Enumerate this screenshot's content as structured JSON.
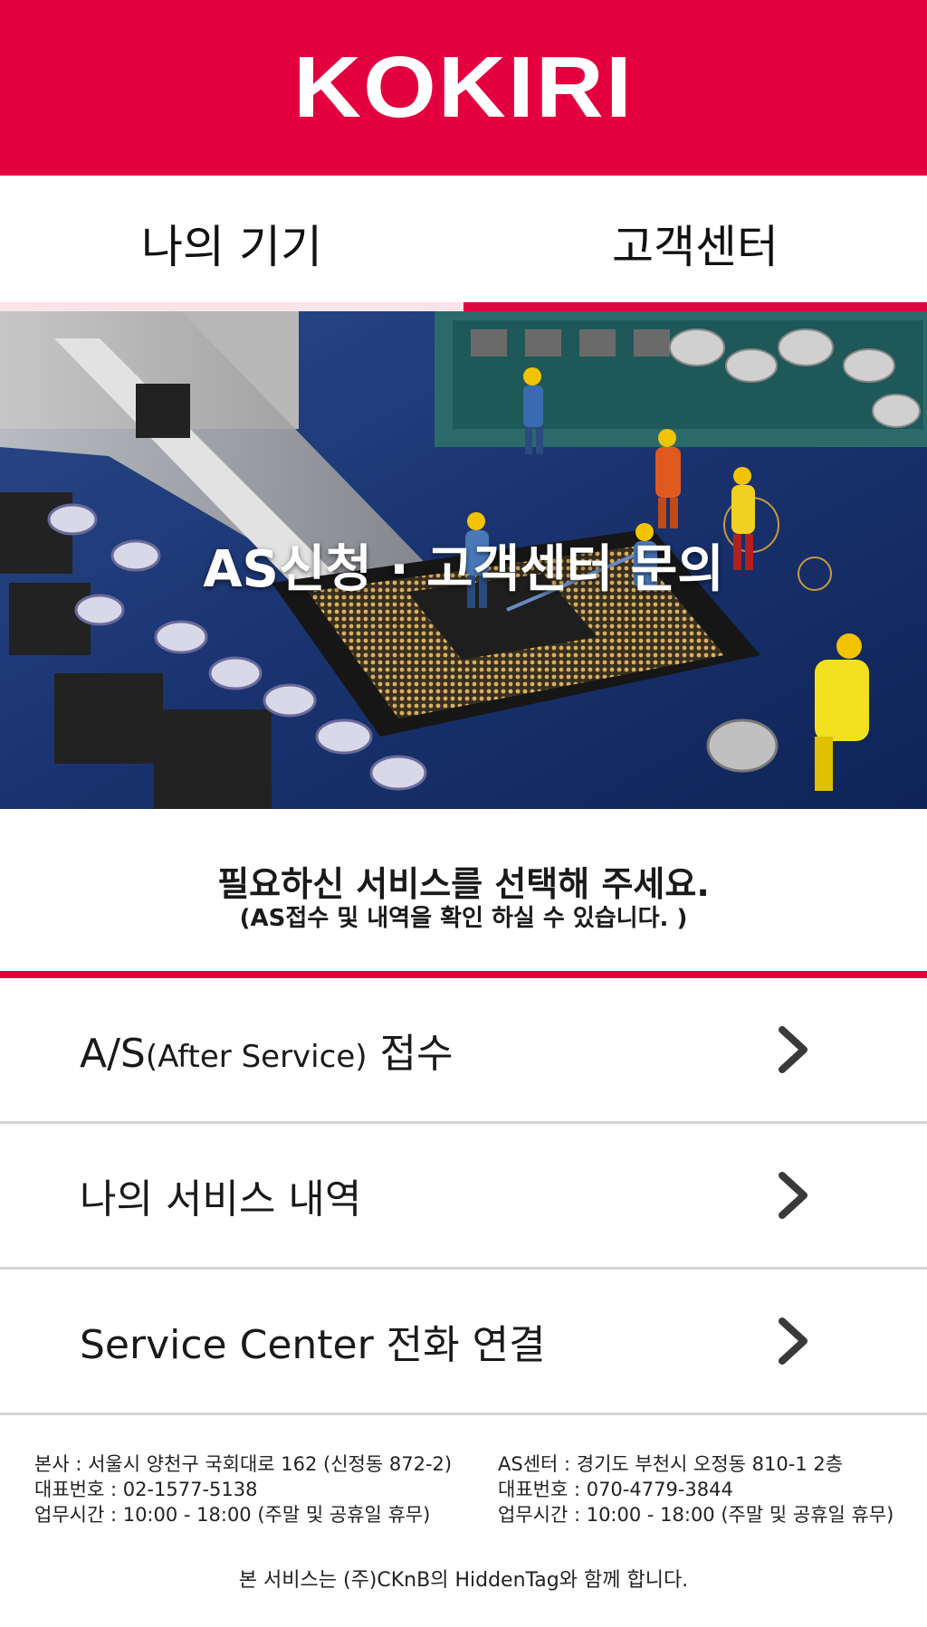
{
  "brand": {
    "logo": "KOKIRI",
    "accent_color": "#e4003f"
  },
  "tabs": [
    {
      "label": "나의 기기",
      "active": false
    },
    {
      "label": "고객센터",
      "active": true
    }
  ],
  "banner": {
    "title": "AS신청 · 고객센터 문의",
    "image": "motherboard-with-miniature-workers"
  },
  "intro": {
    "main": "필요하신 서비스를 선택해 주세요.",
    "sub": "(AS접수 및 내역을 확인 하실 수 있습니다. )"
  },
  "menu": [
    {
      "label_main": "A/S",
      "label_small": "(After Service)",
      "label_tail": " 접수",
      "icon": "chevron-right-icon"
    },
    {
      "label": "나의 서비스 내역",
      "icon": "chevron-right-icon"
    },
    {
      "label": "Service Center 전화 연결",
      "icon": "chevron-right-icon"
    }
  ],
  "footer": {
    "hq": [
      "본사 : 서울시 양천구 국회대로 162 (신정동 872-2)",
      "대표번호 : 02-1577-5138",
      "업무시간 : 10:00 - 18:00 (주말 및 공휴일 휴무)"
    ],
    "as_center": [
      "AS센터 : 경기도 부천시 오정동 810-1 2층",
      "대표번호 : 070-4779-3844",
      "업무시간 : 10:00 - 18:00 (주말 및 공휴일 휴무)"
    ],
    "credit": "본 서비스는 (주)CKnB의 HiddenTag와 함께 합니다."
  }
}
